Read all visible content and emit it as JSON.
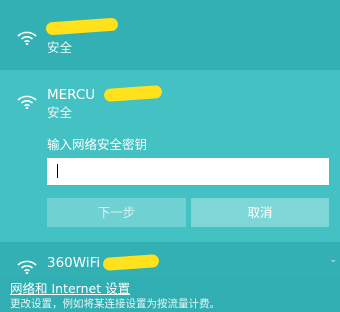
{
  "colors": {
    "panel_bg": "#30aeb1",
    "selected_bg": "#43c1c3",
    "redaction_marker": "#ffe21b"
  },
  "networks": [
    {
      "name": "",
      "status": "安全",
      "icon": "wifi-icon"
    },
    {
      "name": "MERCU",
      "status": "安全",
      "icon": "wifi-icon"
    },
    {
      "name": "360WiFi",
      "icon": "wifi-icon"
    }
  ],
  "connect": {
    "prompt": "输入网络安全密钥",
    "password_value": "",
    "next_label": "下一步",
    "cancel_label": "取消"
  },
  "footer": {
    "settings_link": "网络和 Internet 设置",
    "settings_desc": "更改设置，例如将某连接设置为按流量计费。"
  },
  "scroll_indicator": "⌄"
}
